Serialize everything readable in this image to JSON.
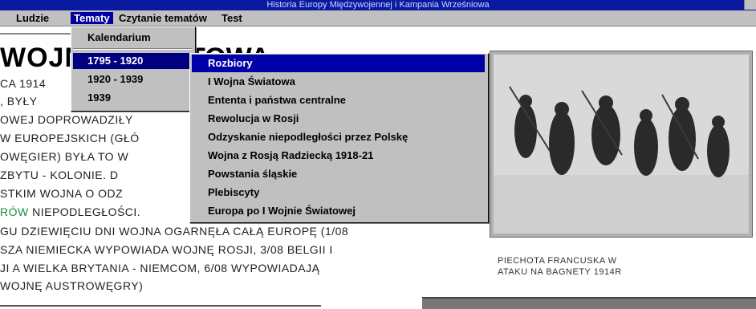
{
  "window": {
    "title": "Historia Europy Międzywojennej i Kampania Wrześniowa"
  },
  "menubar": {
    "items": [
      "Ludzie",
      "Tematy",
      "Czytanie tematów",
      "Test"
    ]
  },
  "tematy_menu": {
    "items": [
      "Kalendarium",
      "1795 - 1920",
      "1920 - 1939",
      "1939"
    ],
    "selected": "1795 - 1920"
  },
  "submenu": {
    "items": [
      "Rozbiory",
      "I Wojna Światowa",
      "Ententa i państwa centralne",
      "Rewolucja w Rosji",
      "Odzyskanie niepodległości przez Polskę",
      "Wojna z Rosją Radziecką 1918-21",
      "Powstania śląskie",
      "Plebiscyty",
      "Europa po I Wojnie Światowej"
    ],
    "selected": "Rozbiory"
  },
  "article": {
    "heading_left": "WOJN",
    "heading_right": "TOWA",
    "lines": [
      "CA 1914",
      ", BYŁY",
      "OWEJ DOPROWADZIŁY",
      "W EUROPEJSKICH (GŁÓ",
      "OWĘGIER) BYŁA TO W",
      " ZBYTU - KOLONIE. D",
      "STKIM WOJNA O ODZ",
      "GU DZIEWIĘCIU DNI WOJNA OGARNĘŁA CAŁĄ EUROPĘ (1/08",
      "SZA NIEMIECKA WYPOWIADA WOJNĘ ROSJI, 3/08 BELGII I",
      "JI A WIELKA BRYTANIA - NIEMCOM, 6/08 WYPOWIADAJĄ",
      "WOJNĘ AUSTROWĘGRY)"
    ],
    "green_word": "RÓW",
    "after_green": " NIEPODLEGŁOŚCI."
  },
  "photo": {
    "caption_line1": "PIECHOTA FRANCUSKA W",
    "caption_line2": "ATAKU NA BAGNETY 1914R"
  },
  "colors": {
    "menu_highlight": "#0000a8",
    "titlebar": "#0a1aa0",
    "menu_bg": "#c0c0c0",
    "green_text": "#1a8a3a"
  }
}
